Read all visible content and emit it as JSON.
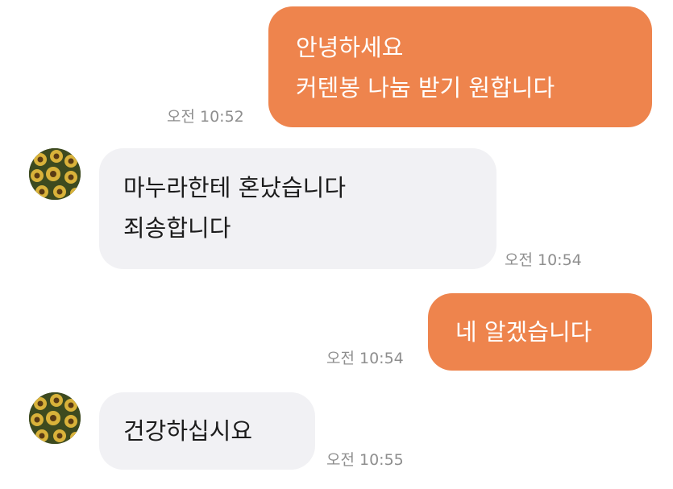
{
  "messages": [
    {
      "direction": "sent",
      "lines": [
        "안녕하세요",
        "커텐봉 나눔 받기 원합니다"
      ],
      "time": "오전 10:52"
    },
    {
      "direction": "received",
      "lines": [
        "마누라한테 혼났습니다",
        "죄송합니다"
      ],
      "time": "오전 10:54",
      "avatar_icon": "sunflower-avatar-icon"
    },
    {
      "direction": "sent",
      "lines": [
        "네 알겠습니다"
      ],
      "time": "오전 10:54"
    },
    {
      "direction": "received",
      "lines": [
        "건강하십시요"
      ],
      "time": "오전 10:55",
      "avatar_icon": "sunflower-avatar-icon"
    }
  ],
  "colors": {
    "sent_bubble": "#ee844d",
    "received_bubble": "#f1f1f4",
    "timestamp": "#8e8e8e"
  }
}
